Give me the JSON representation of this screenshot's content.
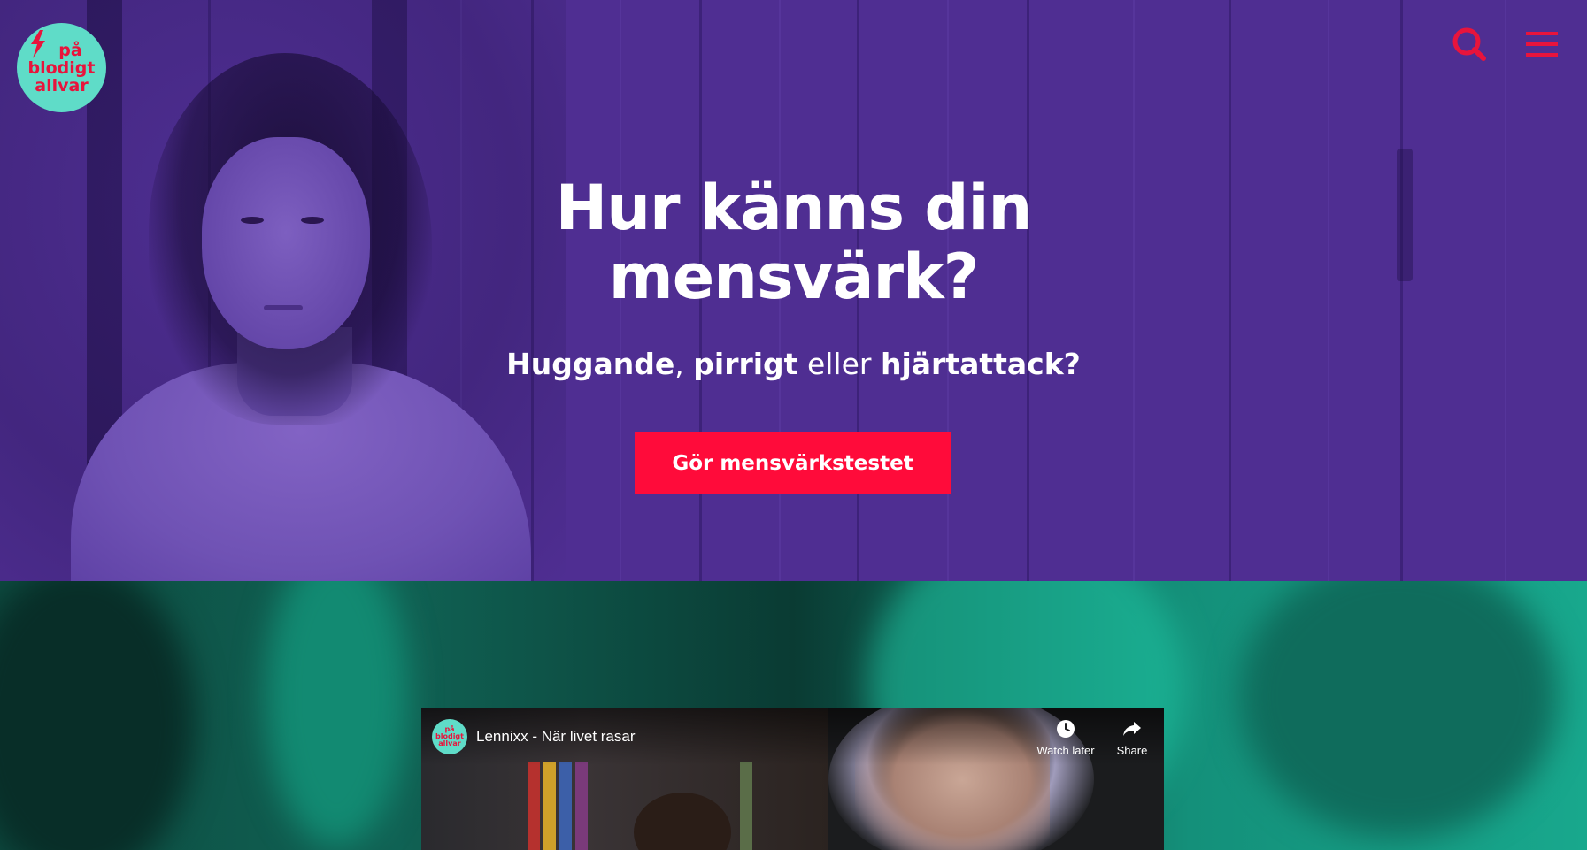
{
  "logo": {
    "line1": "på",
    "line2": "blodigt",
    "line3": "allvar"
  },
  "header": {
    "search_icon": "search-icon",
    "menu_icon": "hamburger-menu-icon"
  },
  "hero": {
    "title_line1": "Hur känns din",
    "title_line2": "mensvärk?",
    "subtitle": {
      "word1": "Huggande",
      "sep1": ", ",
      "word2": "pirrigt",
      "sep2": " eller ",
      "word3": "hjärtattack?"
    },
    "cta_label": "Gör mensvärkstestet"
  },
  "video": {
    "channel": {
      "line1": "på",
      "line2": "blodigt",
      "line3": "allvar"
    },
    "title": "Lennixx - När livet rasar",
    "watch_later_label": "Watch later",
    "share_label": "Share"
  },
  "colors": {
    "hero_bg": "#4f2e92",
    "accent": "#ff0b3a",
    "logo_bg": "#5fdcc8",
    "icon_red": "#e8143c",
    "teal": "#18a88d"
  }
}
